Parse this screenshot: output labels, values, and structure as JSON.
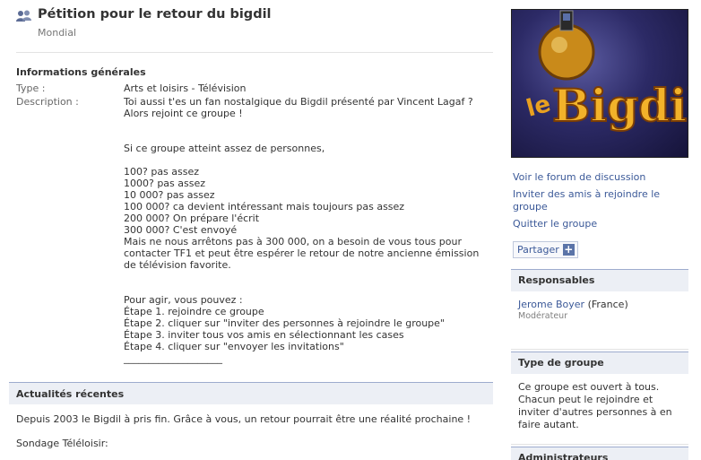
{
  "header": {
    "title": "Pétition pour le retour du bigdil",
    "network": "Mondial"
  },
  "info": {
    "section_title": "Informations générales",
    "type_label": "Type :",
    "type_value": "Arts et loisirs - Télévision",
    "description_label": "Description :",
    "description": "Toi aussi t'es un fan nostalgique du Bigdil présenté par Vincent Lagaf ? Alors rejoint ce groupe !\n\n\nSi ce groupe atteint assez de personnes,\n\n100? pas assez\n1000? pas assez\n10 000? pas assez\n100 000? ca devient intéressant mais toujours pas assez\n200 000? On prépare l'écrit\n300 000? C'est envoyé\nMais ne nous arrêtons pas à 300 000, on a besoin de vous tous pour contacter TF1 et peut être espérer le retour de notre ancienne émission de télévision favorite.\n\n\nPour agir, vous pouvez :\nÉtape 1. rejoindre ce groupe\nÉtape 2. cliquer sur \"inviter des personnes à rejoindre le groupe\"\nÉtape 3. inviter tous vos amis en sélectionnant les cases\nÉtape 4. cliquer sur \"envoyer les invitations\"\n____________________"
  },
  "news": {
    "section_title": "Actualités récentes",
    "text": "Depuis 2003 le Bigdil à pris fin. Grâce à vous, un retour pourrait être une réalité prochaine !",
    "poll": "Sondage Téléloisir:"
  },
  "sidebar": {
    "logo_text": "Bigdil",
    "logo_prefix": "le",
    "actions": [
      {
        "label": "Voir le forum de discussion"
      },
      {
        "label": "Inviter des amis à rejoindre le groupe"
      },
      {
        "label": "Quitter le groupe"
      }
    ],
    "share_label": "Partager",
    "share_plus": "+",
    "responsables": {
      "title": "Responsables",
      "name": "Jerome Boyer",
      "country": "(France)",
      "role": "Modérateur"
    },
    "group_type": {
      "title": "Type de groupe",
      "text": "Ce groupe est ouvert à tous. Chacun peut le rejoindre et inviter d'autres personnes à en faire autant."
    },
    "admins": {
      "title": "Administrateurs"
    }
  },
  "colors": {
    "link": "#3b5998",
    "section_bg": "#eceff5",
    "section_border": "#9dacce"
  }
}
